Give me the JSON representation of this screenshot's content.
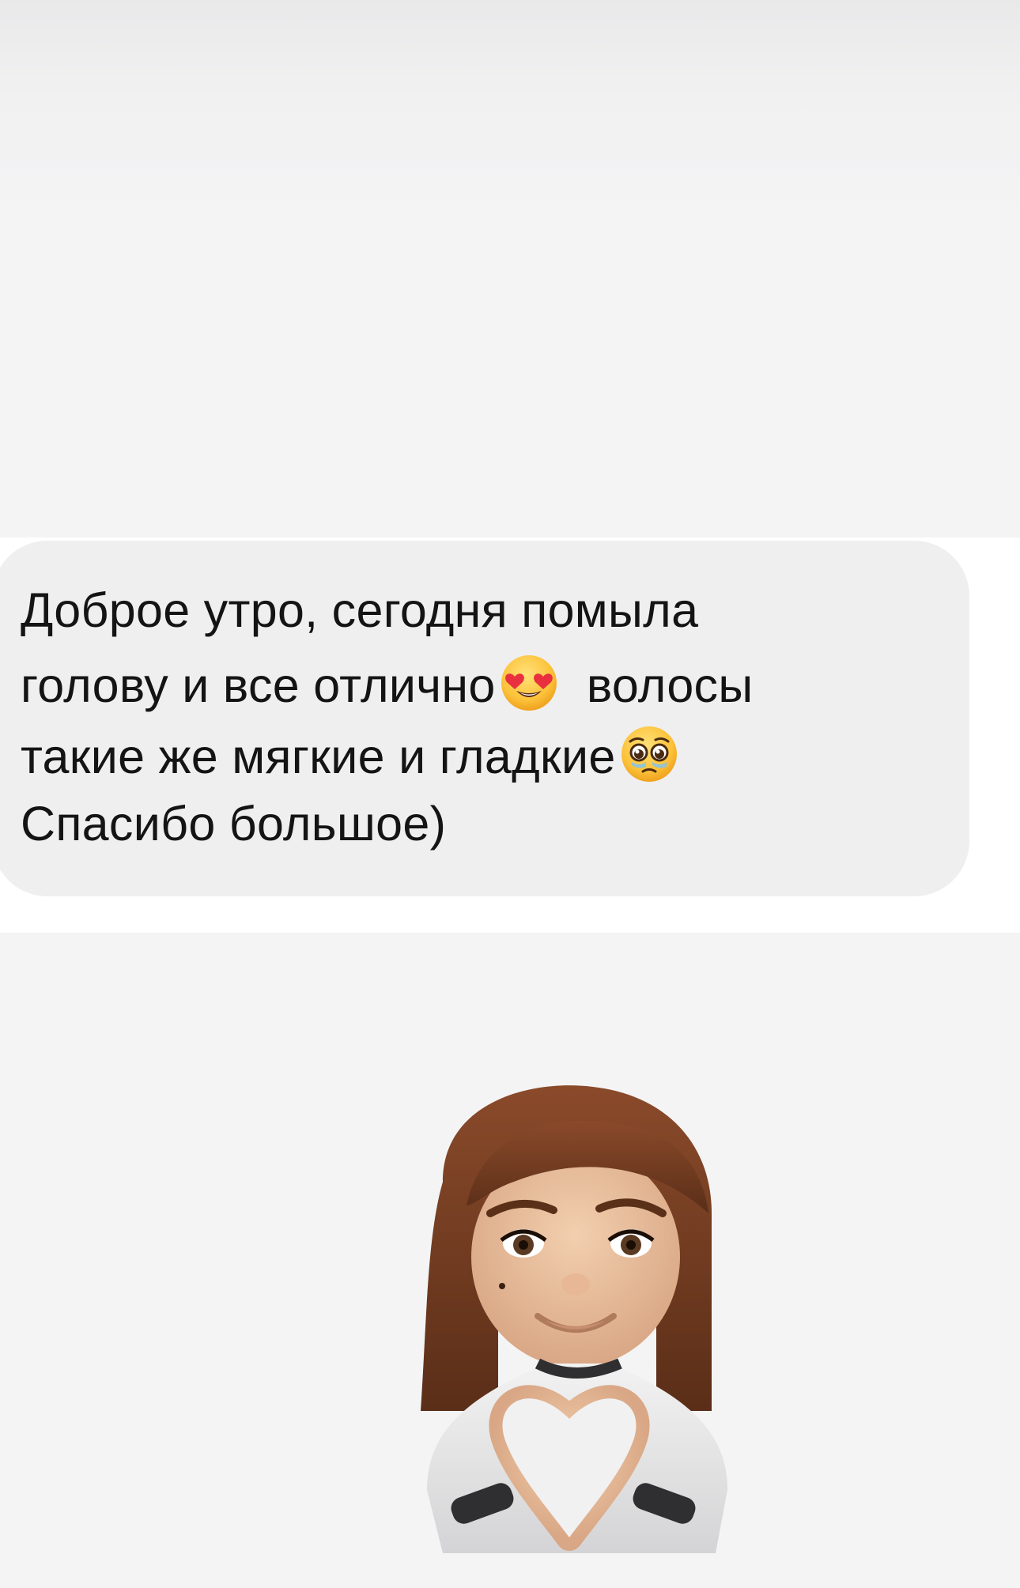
{
  "message": {
    "line1": "Доброе утро, сегодня помыла",
    "line2_text": "голову и все отлично",
    "line2_emoji": "smiling-face-with-heart-eyes-icon",
    "line2_after": "волосы",
    "line3_text": "такие же мягкие и гладкие",
    "line3_emoji": "pleading-face-icon",
    "line4": "Спасибо большое)"
  },
  "sticker": {
    "name": "memoji-heart-hands"
  },
  "colors": {
    "background": "#f4f4f5",
    "bubble": "#efeff0",
    "text": "#141414"
  }
}
